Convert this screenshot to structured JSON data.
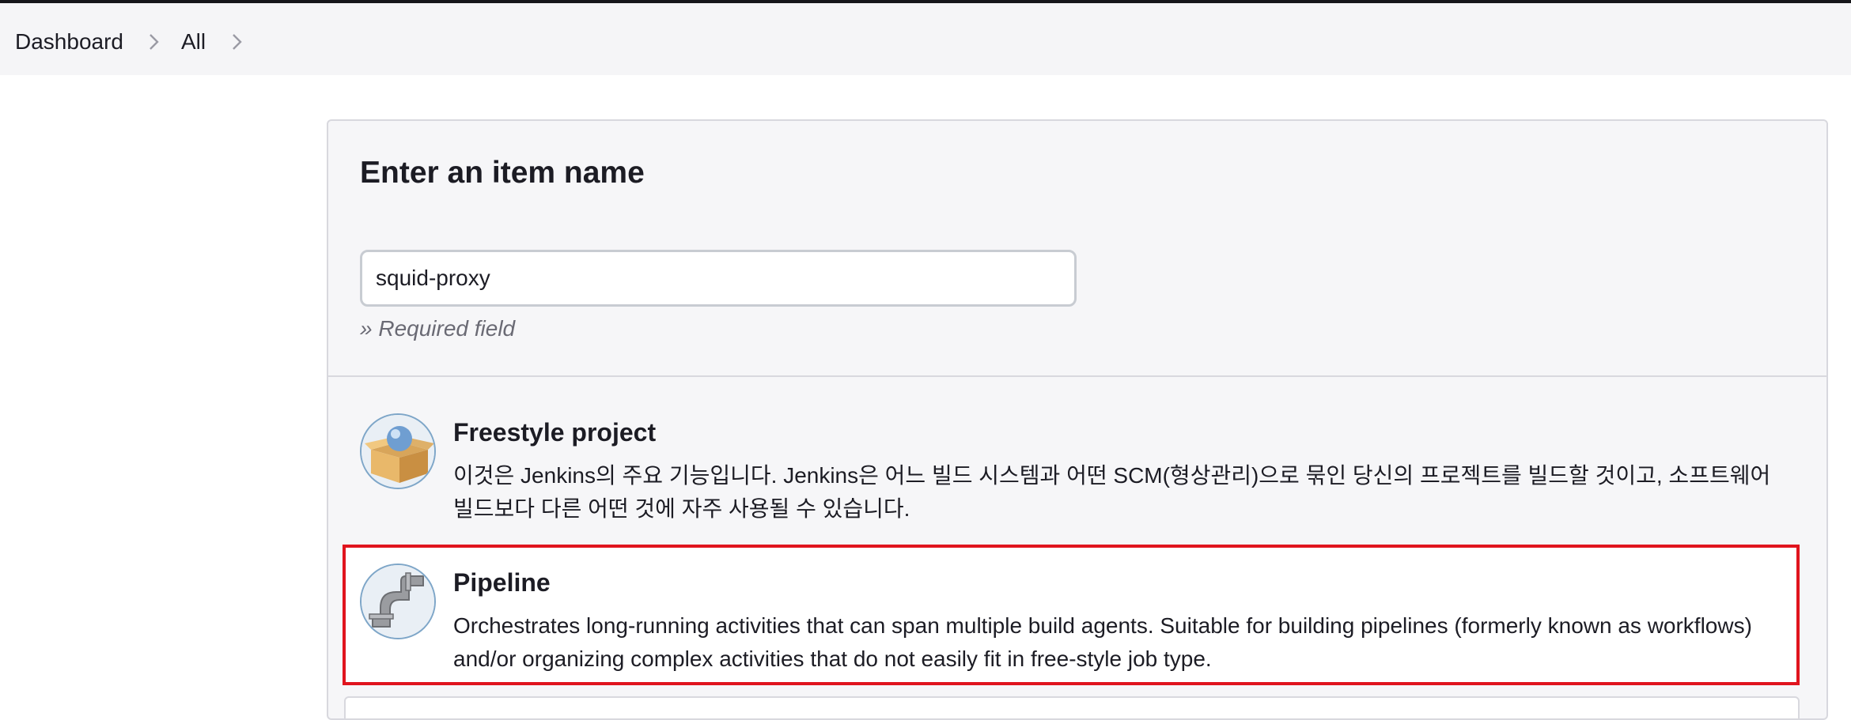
{
  "breadcrumb": {
    "items": [
      "Dashboard",
      "All"
    ]
  },
  "form": {
    "title": "Enter an item name",
    "name_value": "squid-proxy",
    "required_hint": "» Required field"
  },
  "item_types": [
    {
      "title": "Freestyle project",
      "description": "이것은 Jenkins의 주요 기능입니다. Jenkins은 어느 빌드 시스템과 어떤 SCM(형상관리)으로 묶인 당신의 프로젝트를 빌드할 것이고, 소프트웨어 빌드보다 다른 어떤 것에 자주 사용될 수 있습니다.",
      "icon": "freestyle-box-icon"
    },
    {
      "title": "Pipeline",
      "description": "Orchestrates long-running activities that can span multiple build agents. Suitable for building pipelines (formerly known as workflows) and/or organizing complex activities that do not easily fit in free-style job type.",
      "icon": "pipeline-pipe-icon",
      "highlighted": true
    }
  ],
  "colors": {
    "highlight_border": "#e0141e",
    "panel_bg": "#f6f6f8",
    "breadcrumb_bg": "#f5f5f7"
  }
}
